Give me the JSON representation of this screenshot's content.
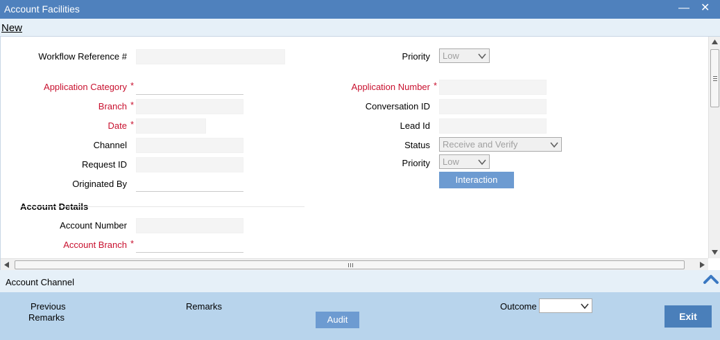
{
  "window": {
    "title": "Account Facilities",
    "minimize": "—",
    "close": "✕"
  },
  "toolbar": {
    "new_label": "New"
  },
  "form": {
    "workflow_reference": {
      "label": "Workflow Reference #",
      "value": ""
    },
    "priority_top": {
      "label": "Priority",
      "value": "Low"
    },
    "application_category": {
      "label": "Application Category",
      "value": ""
    },
    "application_number": {
      "label": "Application Number",
      "value": ""
    },
    "branch": {
      "label": "Branch",
      "value": ""
    },
    "conversation_id": {
      "label": "Conversation ID",
      "value": ""
    },
    "date": {
      "label": "Date",
      "value": ""
    },
    "lead_id": {
      "label": "Lead Id",
      "value": ""
    },
    "channel": {
      "label": "Channel",
      "value": ""
    },
    "status": {
      "label": "Status",
      "value": "Receive and Verify"
    },
    "request_id": {
      "label": "Request ID",
      "value": ""
    },
    "priority": {
      "label": "Priority",
      "value": "Low"
    },
    "originated_by": {
      "label": "Originated By",
      "value": ""
    },
    "interaction_button": "Interaction",
    "required_mark": "*"
  },
  "account_details": {
    "title": "Account Details",
    "account_number": {
      "label": "Account Number",
      "value": ""
    },
    "account_branch": {
      "label": "Account Branch",
      "value": ""
    }
  },
  "channel_bar": {
    "label": "Account Channel"
  },
  "footer": {
    "previous_remarks_1": "Previous",
    "previous_remarks_2": "Remarks",
    "remarks": "Remarks",
    "audit_button": "Audit",
    "outcome_label": "Outcome",
    "outcome_value": "",
    "exit_button": "Exit"
  },
  "colors": {
    "title_bar": "#4f81bd",
    "required": "#c8102e",
    "button": "#6d9bd1",
    "footer": "#b8d4ec"
  }
}
